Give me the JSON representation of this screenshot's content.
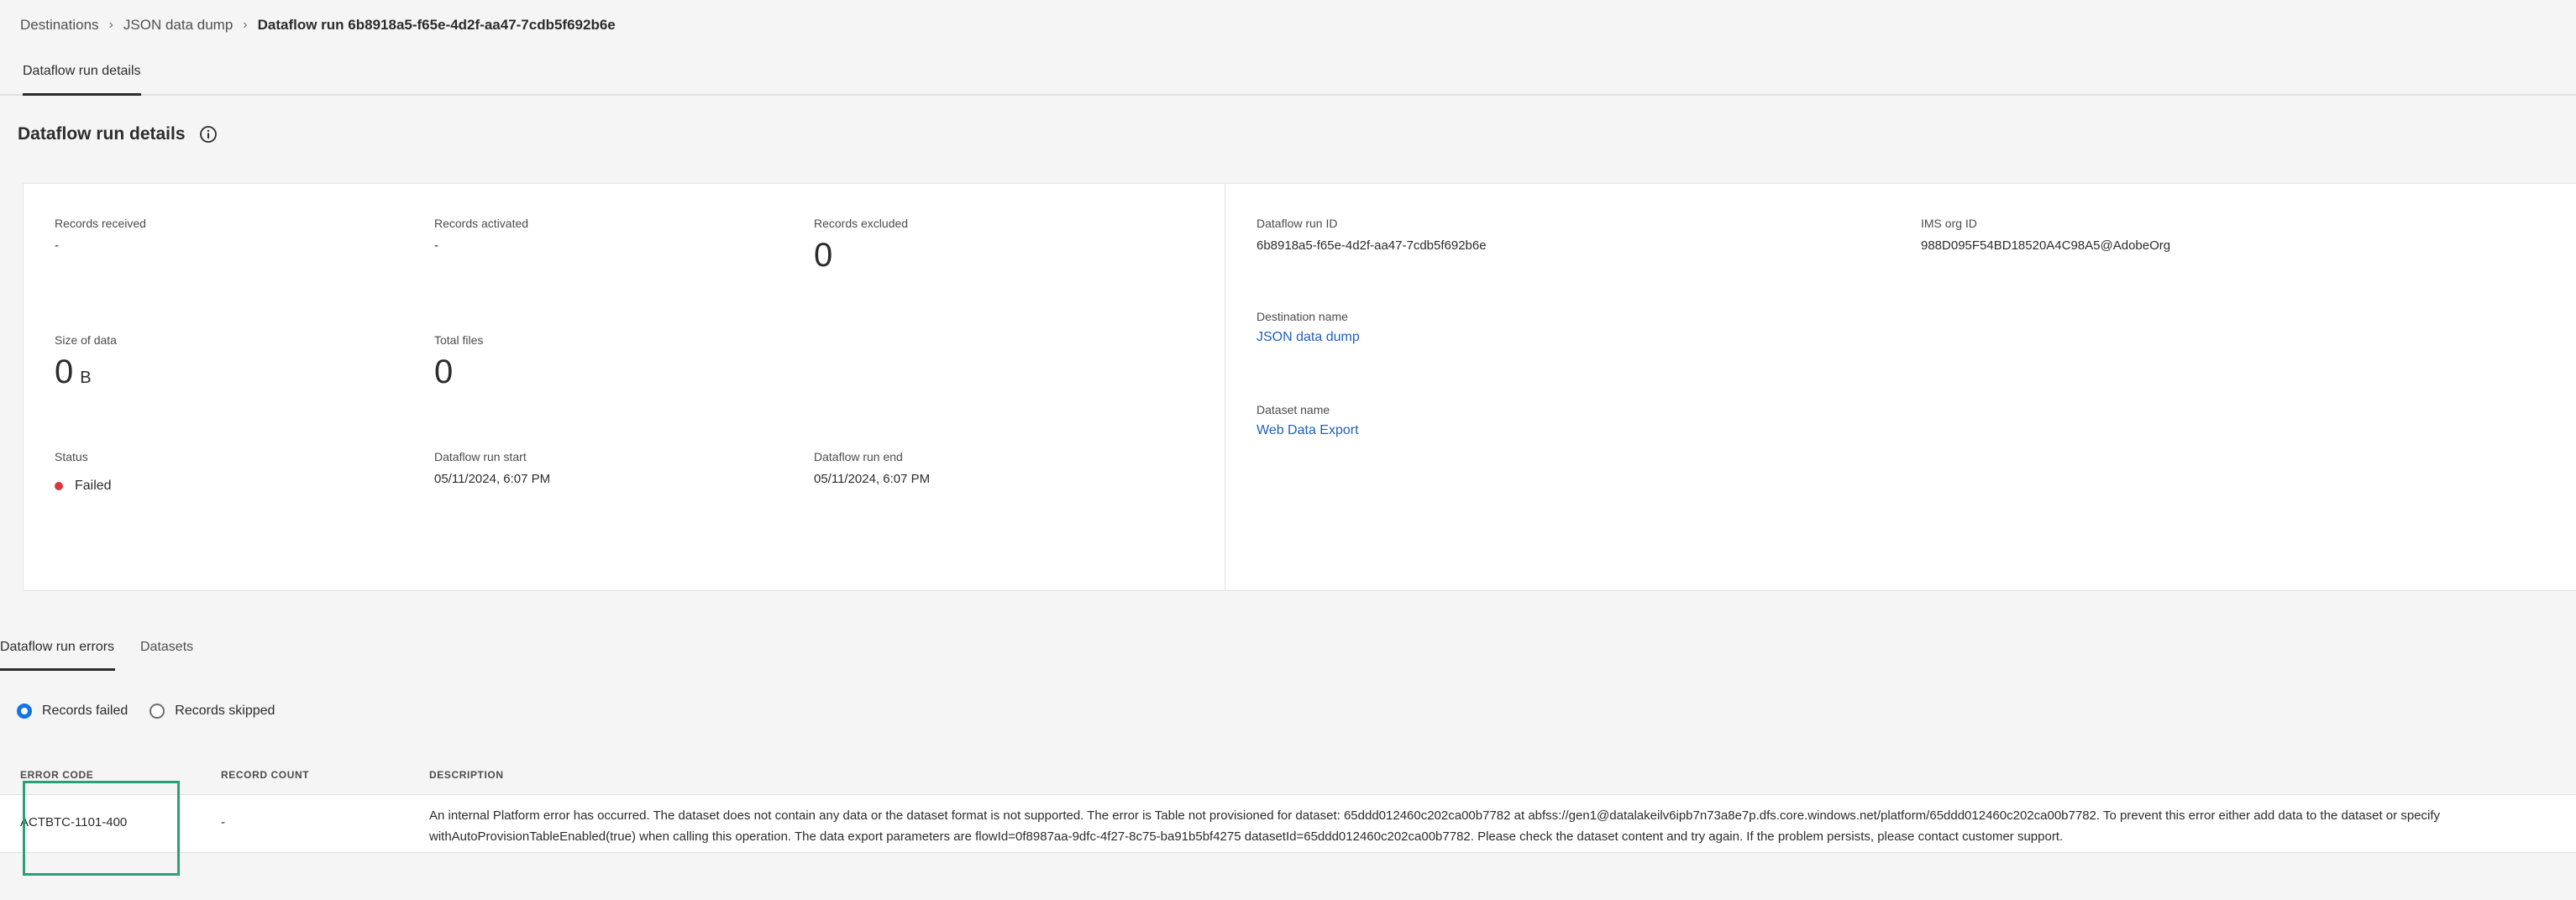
{
  "breadcrumb": {
    "items": [
      "Destinations",
      "JSON data dump"
    ],
    "current": "Dataflow run 6b8918a5-f65e-4d2f-aa47-7cdb5f692b6e"
  },
  "top_tabs": [
    {
      "label": "Dataflow run details",
      "active": true
    }
  ],
  "section_title": "Dataflow run details",
  "stats": {
    "records_received": {
      "label": "Records received",
      "value": "-"
    },
    "records_activated": {
      "label": "Records activated",
      "value": "-"
    },
    "records_excluded": {
      "label": "Records excluded",
      "value": "0"
    },
    "size_of_data": {
      "label": "Size of data",
      "value": "0",
      "unit": "B"
    },
    "total_files": {
      "label": "Total files",
      "value": "0"
    },
    "status": {
      "label": "Status",
      "value": "Failed",
      "color": "#d7373f"
    },
    "run_start": {
      "label": "Dataflow run start",
      "value": "05/11/2024, 6:07 PM"
    },
    "run_end": {
      "label": "Dataflow run end",
      "value": "05/11/2024, 6:07 PM"
    }
  },
  "details": {
    "run_id": {
      "label": "Dataflow run ID",
      "value": "6b8918a5-f65e-4d2f-aa47-7cdb5f692b6e"
    },
    "ims_org": {
      "label": "IMS org ID",
      "value": "988D095F54BD18520A4C98A5@AdobeOrg"
    },
    "destination": {
      "label": "Destination name",
      "value": "JSON data dump"
    },
    "dataset": {
      "label": "Dataset name",
      "value": "Web Data Export"
    }
  },
  "lower_tabs": [
    {
      "label": "Dataflow run errors",
      "active": true
    },
    {
      "label": "Datasets",
      "active": false
    }
  ],
  "radios": [
    {
      "label": "Records failed",
      "checked": true
    },
    {
      "label": "Records skipped",
      "checked": false
    }
  ],
  "table": {
    "headers": [
      "ERROR CODE",
      "RECORD COUNT",
      "DESCRIPTION"
    ],
    "rows": [
      {
        "error_code": "ACTBTC-1101-400",
        "record_count": "-",
        "description": "An internal Platform error has occurred. The dataset does not contain any data or the dataset format is not supported. The error is Table not provisioned for dataset: 65ddd012460c202ca00b7782 at abfss://gen1@datalakeilv6ipb7n73a8e7p.dfs.core.windows.net/platform/65ddd012460c202ca00b7782. To prevent this error either add data to the dataset or specify withAutoProvisionTableEnabled(true) when calling this operation. The data export parameters are flowId=0f8987aa-9dfc-4f27-8c75-ba91b5bf4275 datasetId=65ddd012460c202ca00b7782. Please check the dataset content and try again. If the problem persists, please contact customer support."
      }
    ]
  },
  "colors": {
    "accent": "#1473e6",
    "link": "#1f5fbf",
    "failed": "#d7373f",
    "highlight": "#2b9e7a"
  }
}
